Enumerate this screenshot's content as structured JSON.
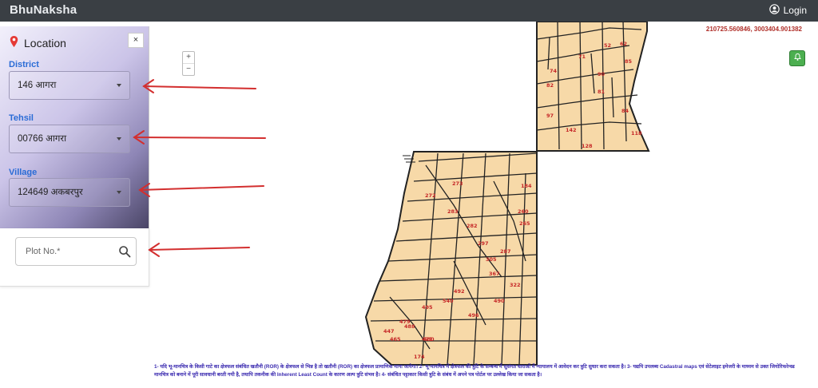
{
  "app": {
    "brand": "BhuNaksha",
    "login_label": "Login"
  },
  "map": {
    "coordinates": "210725.560846, 3003404.901382",
    "zoom_in": "+",
    "zoom_out": "−",
    "parcel_labels": [
      "62",
      "52",
      "71",
      "85",
      "74",
      "90",
      "81",
      "84",
      "82",
      "118",
      "97",
      "128",
      "142",
      "273",
      "272",
      "283",
      "282",
      "297",
      "184",
      "260",
      "265",
      "305",
      "287",
      "367",
      "322",
      "492",
      "490",
      "495",
      "540",
      "496",
      "479",
      "488",
      "480",
      "174",
      "471",
      "465",
      "447"
    ],
    "disclaimer": "1- यदि भू-मानचित्र के किसी गाटे का क्षेत्रफल संबंधित खतौनी (ROR) के क्षेत्रफल से भिन्न है तो खतौनी (ROR) का क्षेत्रफल प्रामाणिक माना जायेगा। 2- भू-मानचित्र में क्षेत्रफल की त्रुटि के सम्बन्ध में सुसंगत धाराओं में न्यायालय में आवेदन कर त्रुटि सुधार करा सकता है। 3- यद्यपि उपलब्ध Cadastral maps एवं सेटेलाइट इमेजरी के माध्यम से उक्त जियोरिफरेन्स्ड मानचित्र को बनाने में पूरी सावधानी बरती गयी है, तथापि तकनीक की Inherent Least Count के कारण अल्प त्रुटि संभव है। 4- संबंधित पट्टाकार किसी त्रुटि के संबंध में अपने पत्र पोर्टल पर उल्लेख किया जा सकता है।"
  },
  "panel": {
    "title": "Location",
    "close_label": "×",
    "district": {
      "label": "District",
      "value": "146 आगरा"
    },
    "tehsil": {
      "label": "Tehsil",
      "value": "00766 आगरा"
    },
    "village": {
      "label": "Village",
      "value": "124649 अकबरपुर"
    },
    "plot": {
      "placeholder": "Plot No.*"
    }
  },
  "colors": {
    "accent": "#2a6cd6",
    "annotation_arrow": "#d32f2f",
    "parcel_fill": "#f7d9a8",
    "parcel_label": "#c62828"
  },
  "icons": {
    "login": "user-circle-icon",
    "location": "map-pin-icon",
    "search": "search-icon",
    "bell": "bell-icon"
  }
}
